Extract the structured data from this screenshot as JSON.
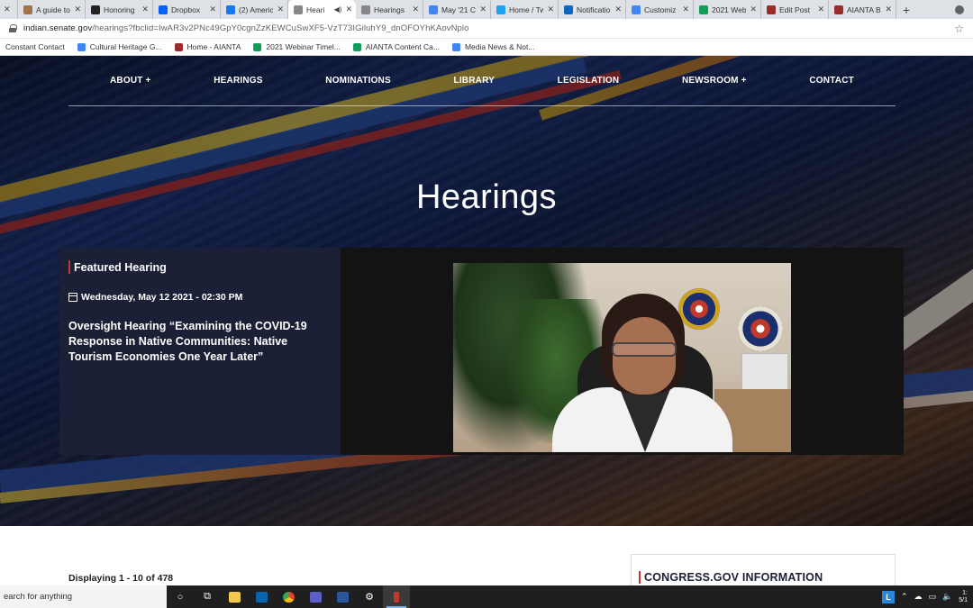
{
  "browser": {
    "tabs": [
      {
        "title": "",
        "color": "#5f6368",
        "active": false
      },
      {
        "title": "A guide to",
        "color": "#a0734a",
        "active": false
      },
      {
        "title": "Honoring",
        "color": "#222222",
        "active": false
      },
      {
        "title": "Dropbox",
        "color": "#0061ff",
        "active": false
      },
      {
        "title": "(2) Americ",
        "color": "#1877f2",
        "active": false
      },
      {
        "title": "Heari",
        "color": "#888888",
        "active": true
      },
      {
        "title": "Hearings",
        "color": "#888888",
        "active": false
      },
      {
        "title": "May '21 C",
        "color": "#4285f4",
        "active": false
      },
      {
        "title": "Home / Tw",
        "color": "#1da1f2",
        "active": false
      },
      {
        "title": "Notificatio",
        "color": "#0a66c2",
        "active": false
      },
      {
        "title": "Customiz",
        "color": "#4285f4",
        "active": false
      },
      {
        "title": "2021 Web",
        "color": "#0f9d58",
        "active": false
      },
      {
        "title": "Edit Post",
        "color": "#9b2c2c",
        "active": false
      },
      {
        "title": "AIANTA B",
        "color": "#9b2c2c",
        "active": false
      }
    ],
    "new_tab": "+",
    "url_domain": "indian.senate.gov",
    "url_rest": "/hearings?fbclid=IwAR3v2PNc49GpY0cgnZzKEWCuSwXF5-VzT73IGiluhY9_dnOFOYhKAovNplo",
    "bookmarks": [
      {
        "label": "Constant Contact",
        "color": ""
      },
      {
        "label": "Cultural Heritage G...",
        "color": "#4285f4"
      },
      {
        "label": "Home - AIANTA",
        "color": "#9b2c2c"
      },
      {
        "label": "2021 Webinar Timel...",
        "color": "#0f9d58"
      },
      {
        "label": "AIANTA Content Ca...",
        "color": "#0f9d58"
      },
      {
        "label": "Media News & Not...",
        "color": "#4285f4"
      }
    ]
  },
  "nav": {
    "items": [
      "ABOUT +",
      "HEARINGS",
      "NOMINATIONS",
      "LIBRARY",
      "LEGISLATION",
      "NEWSROOM +",
      "CONTACT"
    ]
  },
  "hero": {
    "title": "Hearings"
  },
  "featured": {
    "label": "Featured Hearing",
    "date": "Wednesday, May 12 2021 - 02:30 PM",
    "title": "Oversight Hearing “Examining the COVID-19 Response in Native Communities: Native Tourism Economies One Year Later”"
  },
  "listing": {
    "displaying": "Displaying 1 - 10 of 478"
  },
  "sidebar": {
    "title": "CONGRESS.GOV INFORMATION"
  },
  "taskbar": {
    "search_placeholder": "earch for anything",
    "clock_time": "1:",
    "clock_date": "5/1"
  },
  "colors": {
    "accent_red": "#c0392b",
    "panel_navy": "#1b2036"
  }
}
